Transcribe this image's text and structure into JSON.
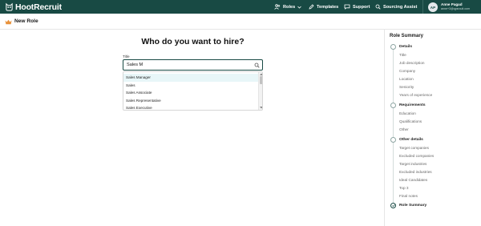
{
  "app": {
    "brand": "HootRecruit",
    "brand_color": "#184a44"
  },
  "nav": {
    "roles": "Roles",
    "templates": "Templates",
    "support": "Support",
    "sourcing_assist": "Sourcing Assist"
  },
  "user": {
    "initials": "AP",
    "name": "Anne Pagad",
    "email": "anne+3@qpsrcuit.com"
  },
  "page": {
    "title": "New Role"
  },
  "main": {
    "question": "Who do you want to hire?",
    "field_label": "Title",
    "input_value": "Sales M",
    "suggestions": [
      {
        "label": "Sales Manager",
        "highlighted": true
      },
      {
        "label": "Sales",
        "highlighted": false
      },
      {
        "label": "Sales Associate",
        "highlighted": false
      },
      {
        "label": "Sales Representative",
        "highlighted": false
      },
      {
        "label": "Sales Executive",
        "highlighted": false
      }
    ]
  },
  "summary": {
    "title": "Role Summary",
    "sections": [
      {
        "label": "Details",
        "items": [
          "Title",
          "Job description",
          "Company",
          "Location",
          "Seniority",
          "Years of experience"
        ]
      },
      {
        "label": "Requirements",
        "items": [
          "Education",
          "Qualifications",
          "Other"
        ]
      },
      {
        "label": "Other details",
        "items": [
          "Target companies",
          "Excluded companies",
          "Target industries",
          "Excluded industries",
          "Ideal Candidates",
          "Top 3",
          "Final notes"
        ]
      },
      {
        "label": "Role Summary",
        "items": []
      }
    ]
  }
}
